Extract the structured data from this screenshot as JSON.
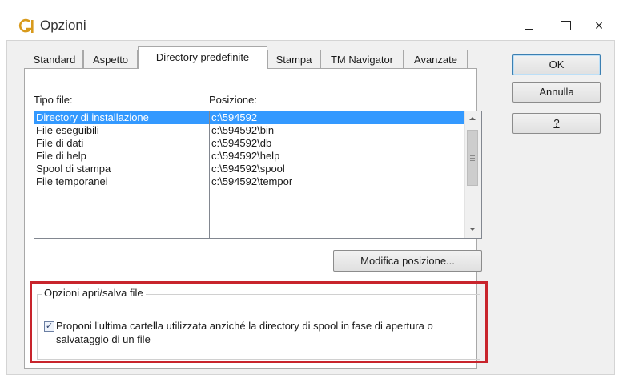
{
  "window": {
    "title": "Opzioni",
    "icon": "app-logo-icon",
    "controls": [
      "minimize-icon",
      "maximize-icon",
      "close-icon"
    ],
    "close_glyph": "×"
  },
  "tabs": [
    {
      "label": "Standard",
      "active": false
    },
    {
      "label": "Aspetto",
      "active": false
    },
    {
      "label": "Directory predefinite",
      "active": true
    },
    {
      "label": "Stampa",
      "active": false
    },
    {
      "label": "TM Navigator",
      "active": false
    },
    {
      "label": "Avanzate",
      "active": false
    }
  ],
  "panel": {
    "type_label": "Tipo file:",
    "position_label": "Posizione:",
    "file_types": [
      "Directory di installazione",
      "File eseguibili",
      "File di dati",
      "File di help",
      "Spool di stampa",
      "File temporanei"
    ],
    "positions": [
      "c:\\594592",
      "c:\\594592\\bin",
      "c:\\594592\\db",
      "c:\\594592\\help",
      "c:\\594592\\spool",
      "c:\\594592\\tempor"
    ],
    "selected_index": 0,
    "modify_button": "Modifica posizione...",
    "group_title": "Opzioni apri/salva file",
    "checkbox_checked": true,
    "checkbox_label": "Proponi l'ultima cartella utilizzata anziché la directory di spool in fase di apertura o salvataggio di un file"
  },
  "buttons": {
    "ok": "OK",
    "cancel": "Annulla",
    "help": "?"
  },
  "colors": {
    "selection": "#3399ff",
    "highlight_frame": "#c8242c",
    "logo": "#d89a1c"
  }
}
